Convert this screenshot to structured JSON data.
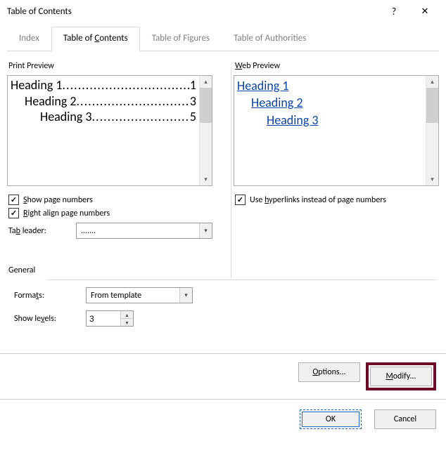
{
  "title": "Table of Contents",
  "tabs": [
    "Index",
    "Table of Contents",
    "Table of Figures",
    "Table of Authorities"
  ],
  "tab_ul": [
    "",
    "C",
    "",
    ""
  ],
  "active_tab": 1,
  "print_preview_label": "Print Preview",
  "web_preview_label": "Web Preview",
  "print_preview": [
    {
      "label": "Heading 1",
      "page": "1",
      "level": "h1"
    },
    {
      "label": "Heading 2",
      "page": "3",
      "level": "h2"
    },
    {
      "label": "Heading 3",
      "page": "5",
      "level": "h3"
    }
  ],
  "web_preview": [
    {
      "label": "Heading 1",
      "level": "h1"
    },
    {
      "label": "Heading 2",
      "level": "h2"
    },
    {
      "label": "Heading 3",
      "level": "h3"
    }
  ],
  "show_page_numbers": "Show page numbers",
  "right_align": "Right align page numbers",
  "use_hyperlinks": "Use hyperlinks instead of page numbers",
  "tab_leader_label": "Tab leader:",
  "tab_leader_value": ".......",
  "general_label": "General",
  "formats_label": "Formats:",
  "formats_value": "From template",
  "show_levels_label": "Show levels:",
  "show_levels_value": "3",
  "options_btn": "Options...",
  "modify_btn": "Modify...",
  "ok_btn": "OK",
  "cancel_btn": "Cancel"
}
